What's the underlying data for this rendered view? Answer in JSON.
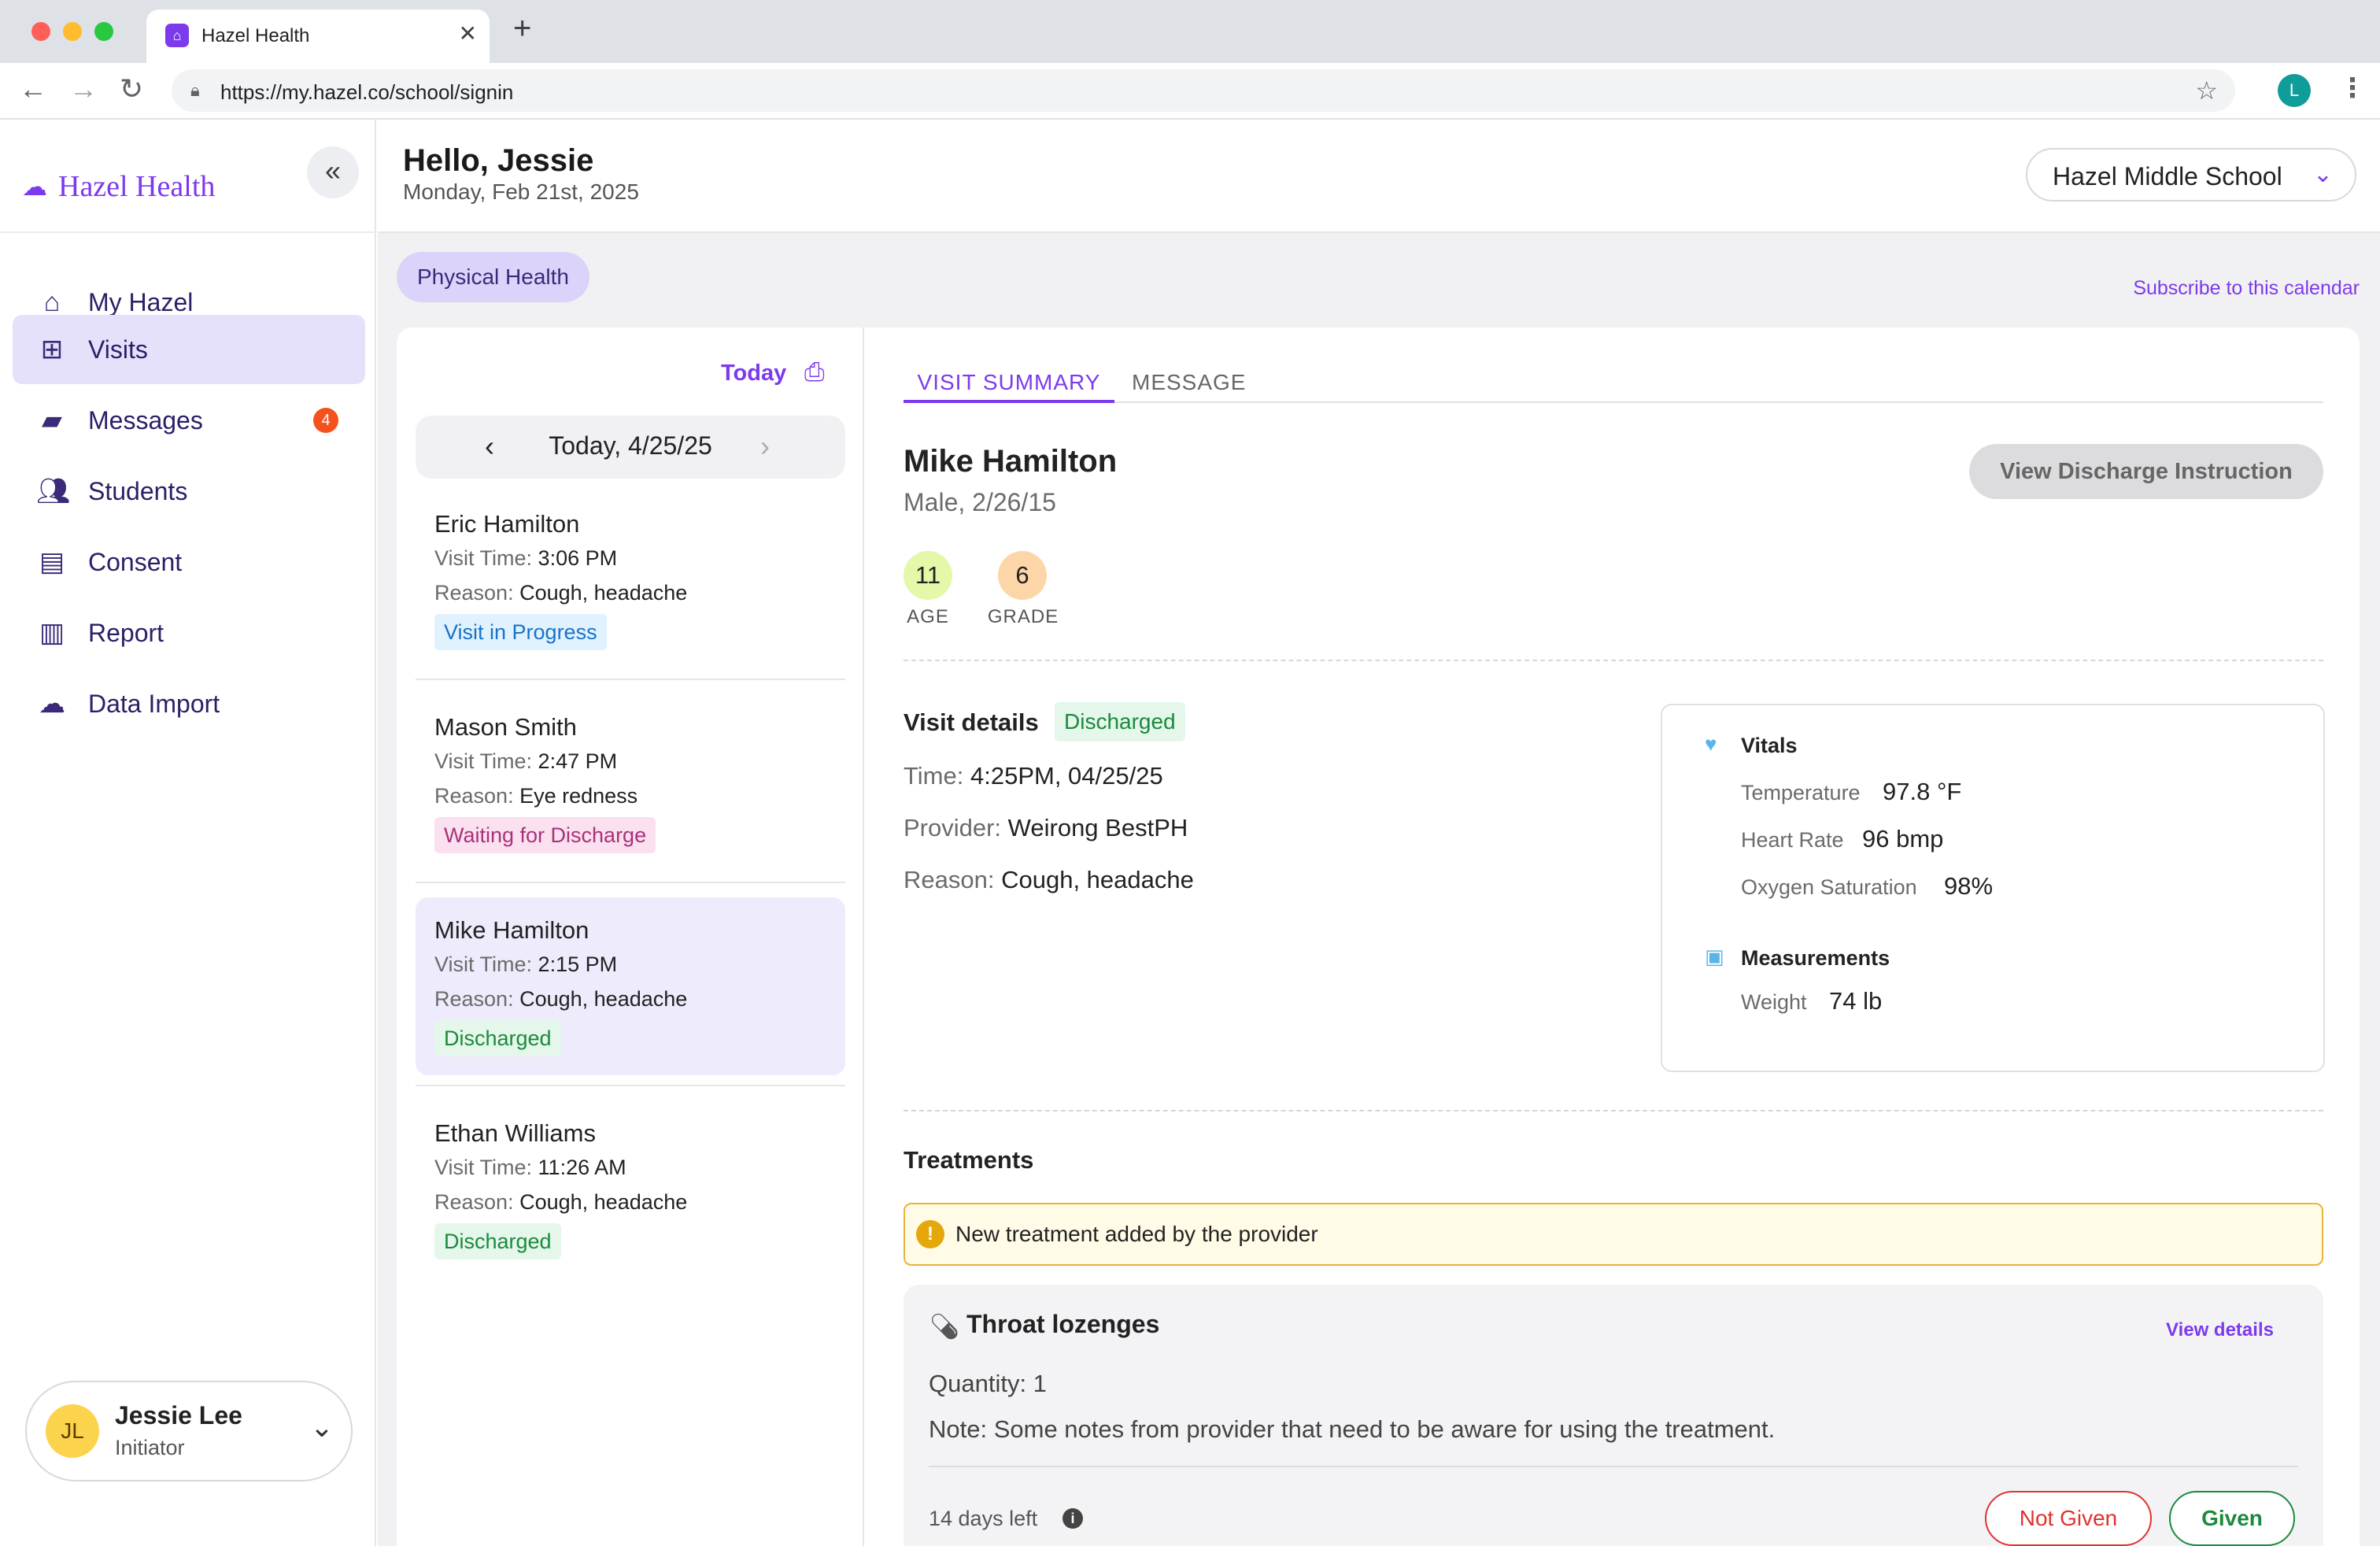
{
  "browser": {
    "tab_title": "Hazel Health",
    "tab_favicon": "hazel-favicon",
    "url": "https://my.hazel.co/school/signin",
    "profile_initial": "L"
  },
  "sidebar": {
    "brand": "Hazel Health",
    "items": [
      {
        "label": "My Hazel",
        "icon": "home-icon"
      },
      {
        "label": "Visits",
        "icon": "monitor-plus-icon",
        "active": true
      },
      {
        "label": "Messages",
        "icon": "chat-icon",
        "badge": "4"
      },
      {
        "label": "Students",
        "icon": "users-icon"
      },
      {
        "label": "Consent",
        "icon": "document-icon"
      },
      {
        "label": "Report",
        "icon": "bar-chart-icon"
      },
      {
        "label": "Data Import",
        "icon": "cloud-upload-icon"
      }
    ],
    "user": {
      "initials": "JL",
      "name": "Jessie Lee",
      "role": "Initiator"
    }
  },
  "header": {
    "greeting": "Hello, Jessie",
    "date": "Monday, Feb 21st, 2025",
    "school": "Hazel Middle School"
  },
  "filter_pill": "Physical Health",
  "subscribe_link": "Subscribe to this calendar",
  "visit_list": {
    "today_label": "Today",
    "date_label": "Today, 4/25/25",
    "time_key": "Visit Time:",
    "reason_key": "Reason:",
    "visits": [
      {
        "name": "Eric Hamilton",
        "time": "3:06 PM",
        "reason": "Cough, headache",
        "status": "Visit in Progress"
      },
      {
        "name": "Mason Smith",
        "time": "2:47 PM",
        "reason": "Eye redness",
        "status": "Waiting for Discharge"
      },
      {
        "name": "Mike Hamilton",
        "time": "2:15 PM",
        "reason": "Cough, headache",
        "status": "Discharged",
        "selected": true
      },
      {
        "name": "Ethan Williams",
        "time": "11:26 AM",
        "reason": "Cough, headache",
        "status": "Discharged"
      }
    ]
  },
  "detail": {
    "tabs": [
      "VISIT SUMMARY",
      "MESSAGE"
    ],
    "patient_name": "Mike Hamilton",
    "patient_meta": "Male, 2/26/15",
    "discharge_button": "View Discharge Instruction",
    "age_value": "11",
    "age_label": "AGE",
    "grade_value": "6",
    "grade_label": "GRADE",
    "visit_details_title": "Visit details",
    "visit_status": "Discharged",
    "time_key": "Time:",
    "time_value": "4:25PM, 04/25/25",
    "provider_key": "Provider:",
    "provider_value": "Weirong BestPH",
    "reason_key": "Reason:",
    "reason_value": "Cough, headache",
    "vitals": {
      "title": "Vitals",
      "temperature_key": "Temperature",
      "temperature_value": "97.8 °F",
      "heart_rate_key": "Heart Rate",
      "heart_rate_value": "96 bmp",
      "oxygen_key": "Oxygen Saturation",
      "oxygen_value": "98%"
    },
    "measurements": {
      "title": "Measurements",
      "weight_key": "Weight",
      "weight_value": "74 lb"
    },
    "treatments_title": "Treatments",
    "alert_text": "New treatment added by the provider",
    "treatment": {
      "name": "Throat lozenges",
      "view_details": "View details",
      "quantity": "Quantity: 1",
      "note": "Note: Some notes from provider that need to be aware for using the treatment.",
      "days_left": "14 days left",
      "not_given": "Not Given",
      "given": "Given"
    }
  },
  "colors": {
    "accent": "#7c3aed",
    "discharged": "#1b8a3d",
    "in_progress": "#1a73c8",
    "waiting": "#a8327a",
    "danger": "#e0332f"
  }
}
